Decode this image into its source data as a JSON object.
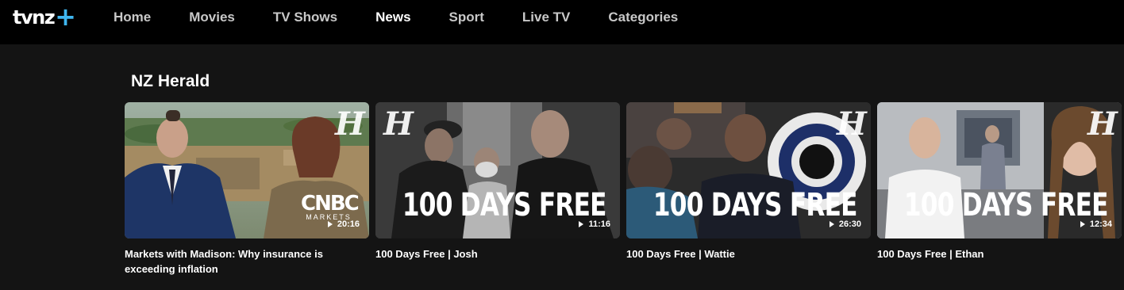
{
  "brand": {
    "logo_text": "tvnz",
    "logo_plus": "+",
    "accent_color": "#3fb6f0"
  },
  "nav": {
    "items": [
      {
        "label": "Home",
        "active": false
      },
      {
        "label": "Movies",
        "active": false
      },
      {
        "label": "TV Shows",
        "active": false
      },
      {
        "label": "News",
        "active": true
      },
      {
        "label": "Sport",
        "active": false
      },
      {
        "label": "Live TV",
        "active": false
      },
      {
        "label": "Categories",
        "active": false
      }
    ]
  },
  "section": {
    "title": "NZ Herald",
    "cards": [
      {
        "title": "Markets with Madison: Why insurance is exceeding inflation",
        "duration": "20:16",
        "overlay": "",
        "herald_mark": "H",
        "brand_logo": "CNBC",
        "brand_sub": "MARKETS"
      },
      {
        "title": "100 Days Free | Josh",
        "duration": "11:16",
        "overlay": "100 DAYS FREE",
        "herald_mark": "H"
      },
      {
        "title": "100 Days Free | Wattie",
        "duration": "26:30",
        "overlay": "100 DAYS FREE",
        "herald_mark": "H"
      },
      {
        "title": "100 Days Free | Ethan",
        "duration": "12:34",
        "overlay": "100 DAYS FREE",
        "herald_mark": "H"
      }
    ]
  }
}
